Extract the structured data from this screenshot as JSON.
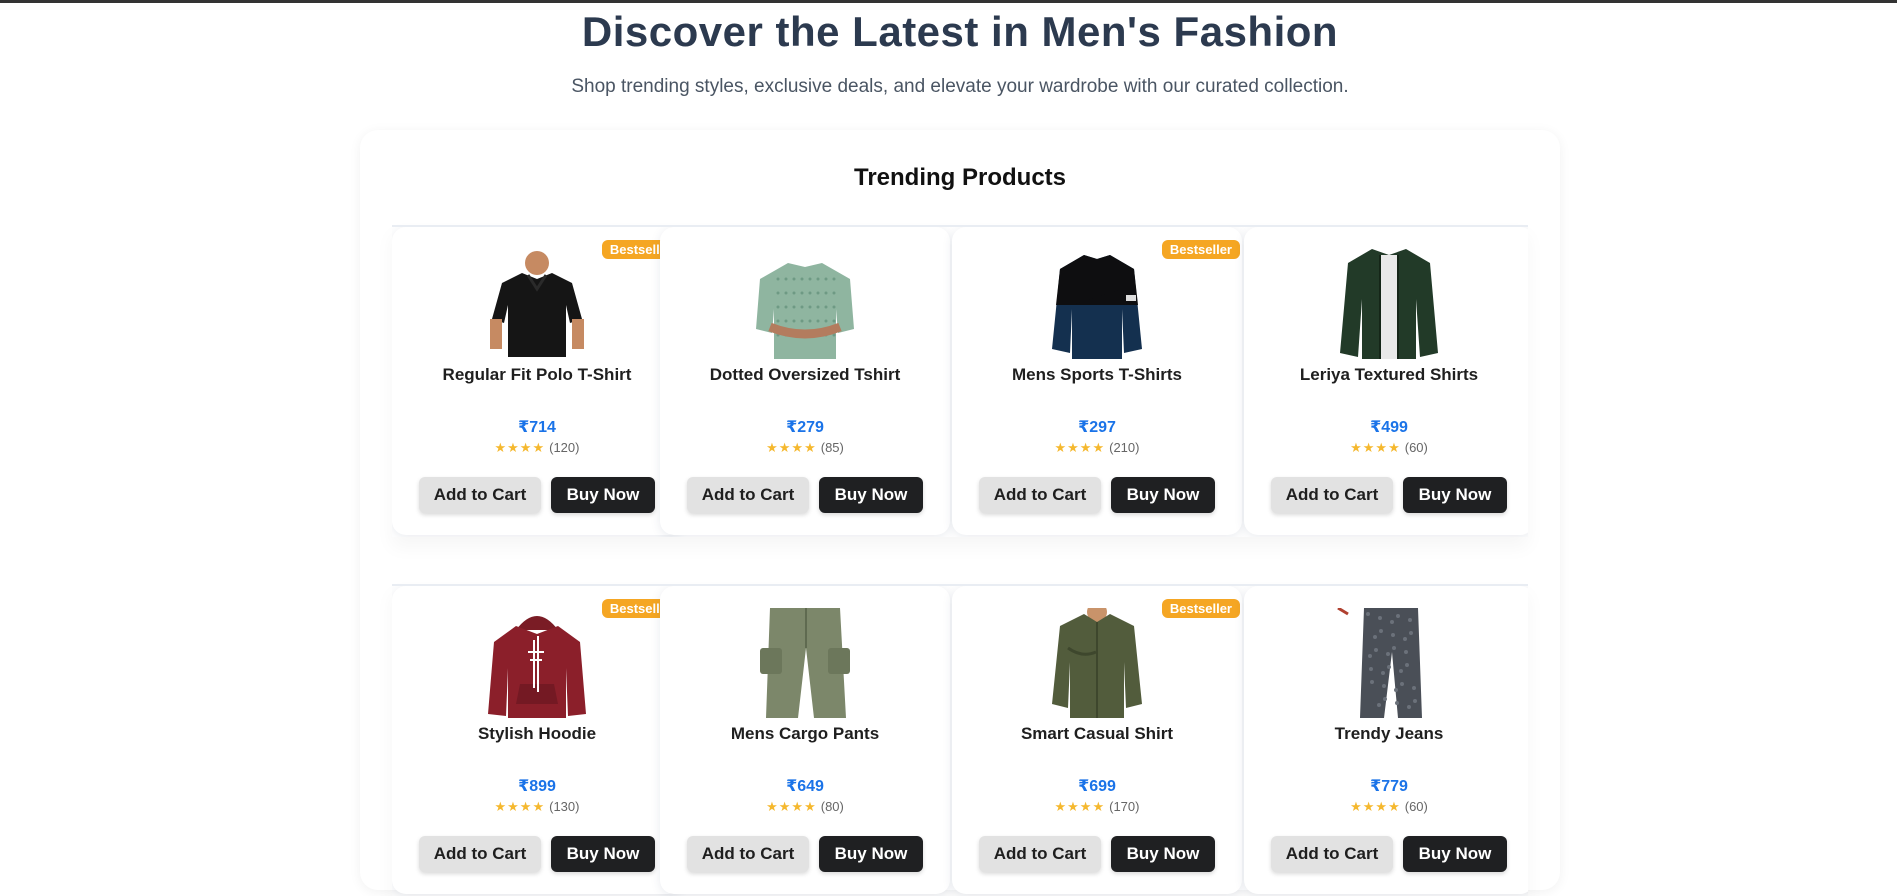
{
  "hero": {
    "title": "Discover the Latest in Men's Fashion",
    "subtitle": "Shop trending styles, exclusive deals, and elevate your wardrobe with our curated collection."
  },
  "section": {
    "title": "Trending Products"
  },
  "colors": {
    "heading": "#2c3a4f",
    "price": "#1a73e8",
    "badge": "#f5a623",
    "star": "#f5b82e",
    "buy_button": "#1f2022",
    "cart_button": "#e2e2e2"
  },
  "products": [
    {
      "name": "Regular Fit Polo T-Shirt",
      "price": "₹714",
      "stars": "★★★★",
      "reviews": "(120)",
      "badge": "Bestseller",
      "add_label": "Add to Cart",
      "buy_label": "Buy Now",
      "icon": "polo-shirt-icon"
    },
    {
      "name": "Dotted Oversized Tshirt",
      "price": "₹279",
      "stars": "★★★★",
      "reviews": "(85)",
      "badge": null,
      "add_label": "Add to Cart",
      "buy_label": "Buy Now",
      "icon": "tshirt-icon"
    },
    {
      "name": "Mens Sports T-Shirts",
      "price": "₹297",
      "stars": "★★★★",
      "reviews": "(210)",
      "badge": "Bestseller",
      "add_label": "Add to Cart",
      "buy_label": "Buy Now",
      "icon": "sports-shirt-icon"
    },
    {
      "name": "Leriya Textured Shirts",
      "price": "₹499",
      "stars": "★★★★",
      "reviews": "(60)",
      "badge": null,
      "add_label": "Add to Cart",
      "buy_label": "Buy Now",
      "icon": "overshirt-icon"
    },
    {
      "name": "Stylish Hoodie",
      "price": "₹899",
      "stars": "★★★★",
      "reviews": "(130)",
      "badge": "Bestseller",
      "add_label": "Add to Cart",
      "buy_label": "Buy Now",
      "icon": "hoodie-icon"
    },
    {
      "name": "Mens Cargo Pants",
      "price": "₹649",
      "stars": "★★★★",
      "reviews": "(80)",
      "badge": null,
      "add_label": "Add to Cart",
      "buy_label": "Buy Now",
      "icon": "cargo-pants-icon"
    },
    {
      "name": "Smart Casual Shirt",
      "price": "₹699",
      "stars": "★★★★",
      "reviews": "(170)",
      "badge": "Bestseller",
      "add_label": "Add to Cart",
      "buy_label": "Buy Now",
      "icon": "casual-shirt-icon"
    },
    {
      "name": "Trendy Jeans",
      "price": "₹779",
      "stars": "★★★★",
      "reviews": "(60)",
      "badge": null,
      "add_label": "Add to Cart",
      "buy_label": "Buy Now",
      "icon": "jeans-icon"
    }
  ]
}
